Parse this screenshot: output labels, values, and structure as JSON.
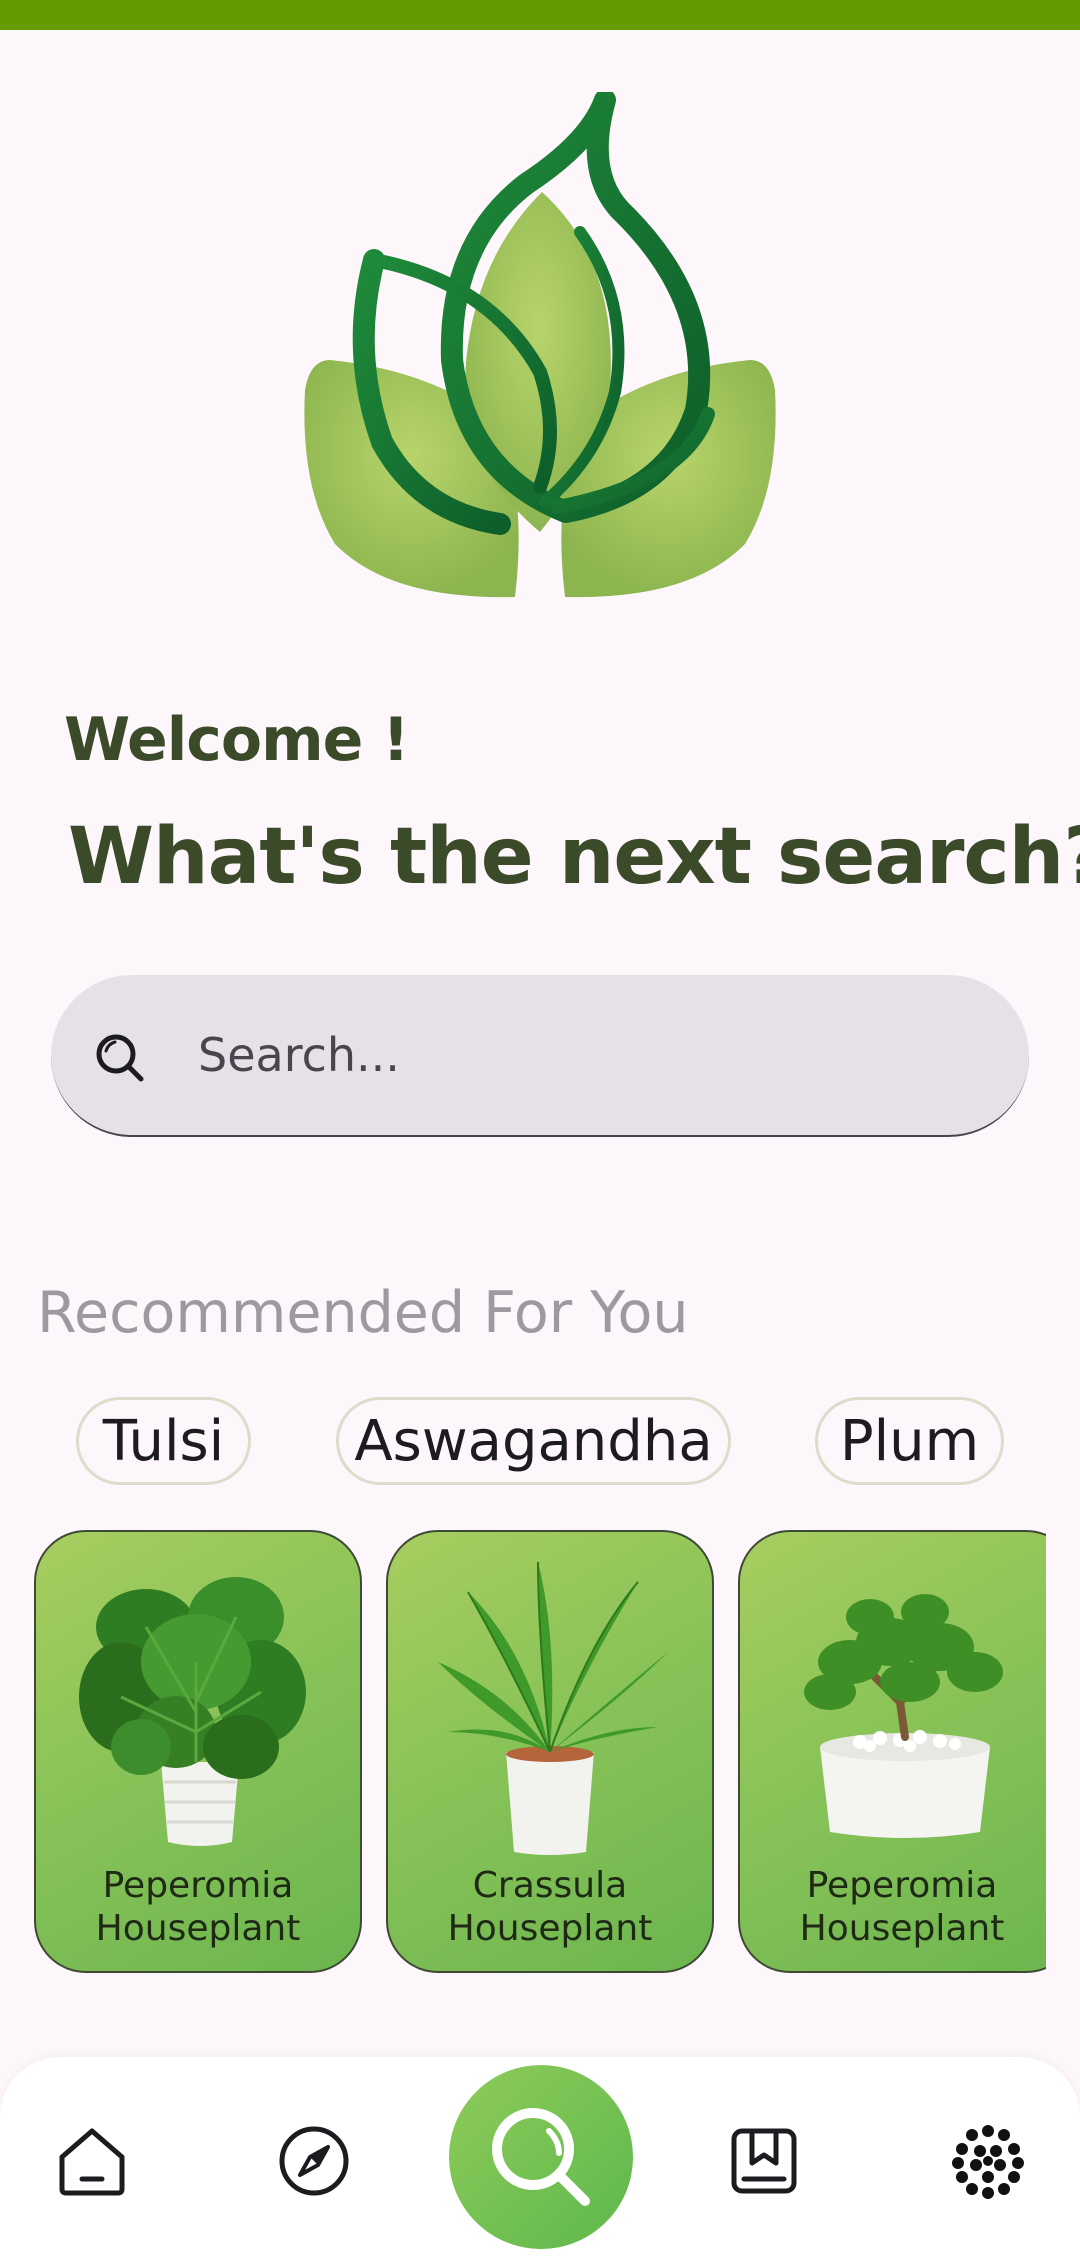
{
  "greeting": "Welcome !",
  "headline": "What's the next search?",
  "search": {
    "placeholder": "Search..."
  },
  "recommended": {
    "title": "Recommended For You",
    "chips": [
      "Tulsi",
      "Aswagandha",
      "Plum"
    ],
    "cards": [
      {
        "line1": "Peperomia",
        "line2": "Houseplant"
      },
      {
        "line1": "Crassula",
        "line2": "Houseplant"
      },
      {
        "line1": "Peperomia",
        "line2": "Houseplant"
      }
    ]
  },
  "nav": {
    "items": [
      "home-icon",
      "compass-icon",
      "search-icon",
      "bookmark-icon",
      "profile-icon"
    ],
    "active": "search-icon"
  },
  "colors": {
    "accent": "#659a00",
    "heading": "#3b4a28",
    "card_gradient_start": "#a8cd5f",
    "card_gradient_end": "#6cb54f"
  }
}
